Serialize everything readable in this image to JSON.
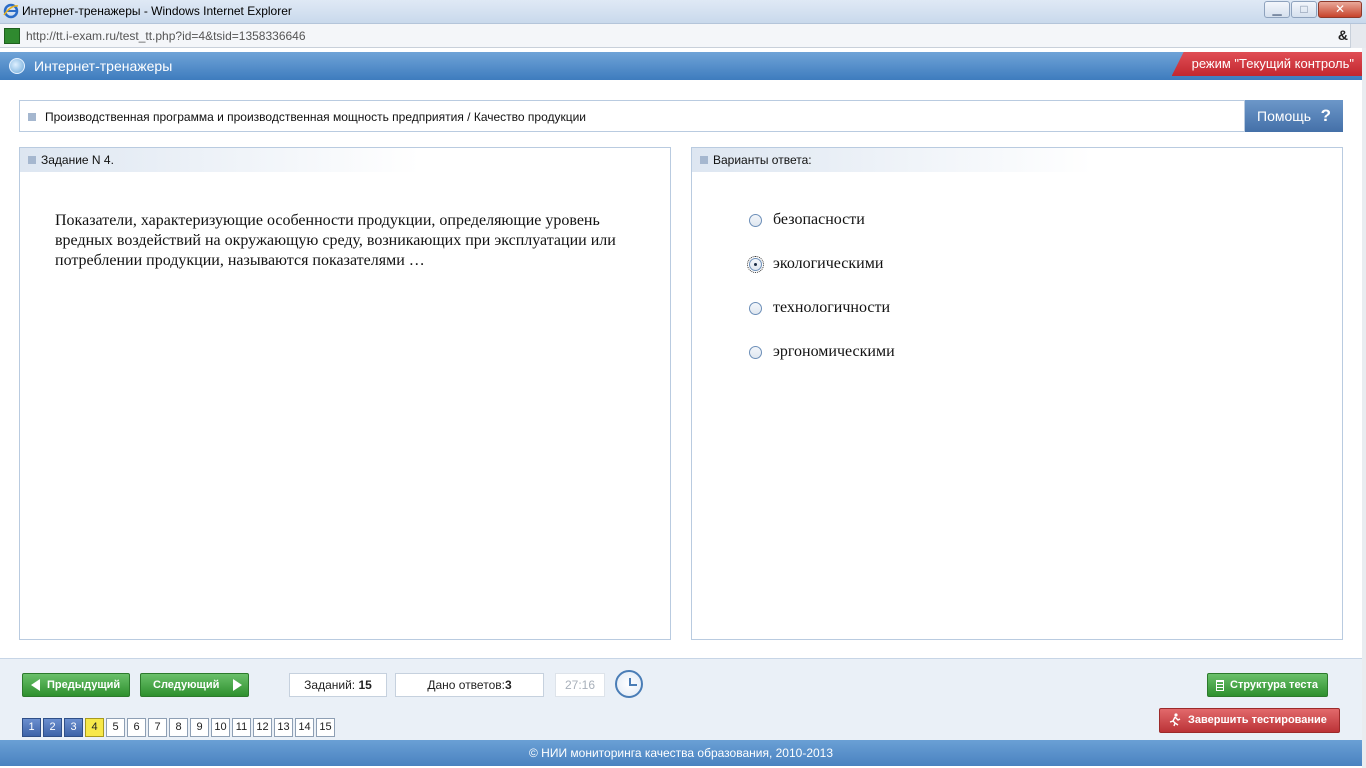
{
  "window": {
    "title": "Интернет-тренажеры - Windows Internet Explorer",
    "url": "http://tt.i-exam.ru/test_tt.php?id=4&tsid=1358336646",
    "min_glyph": "▁",
    "max_glyph": "□",
    "close_glyph": "✕",
    "tools_glyph": "&"
  },
  "app": {
    "title": "Интернет-тренажеры",
    "mode": "режим \"Текущий контроль\""
  },
  "topic": {
    "text": "Производственная программа и производственная мощность предприятия / Качество продукции",
    "help_label": "Помощь",
    "help_icon": "?"
  },
  "question": {
    "header": "Задание N 4.",
    "text": "Показатели, характеризующие особенности продукции, определяющие уровень вредных воздействий на окружающую среду, возникающих при эксплуатации или потреблении продукции, называются показателями …"
  },
  "answers": {
    "header": "Варианты ответа:",
    "options": [
      {
        "label": "безопасности",
        "selected": false
      },
      {
        "label": "экологическими",
        "selected": true
      },
      {
        "label": "технологичности",
        "selected": false
      },
      {
        "label": "эргономическими",
        "selected": false
      }
    ]
  },
  "nav": {
    "prev_label": "Предыдущий",
    "next_label": "Следующий",
    "tasks_label": "Заданий:",
    "tasks_count": "15",
    "answers_label": "Дано ответов:",
    "answers_count": "3",
    "timer": "27:16",
    "structure_label": "Структура теста",
    "finish_label": "Завершить тестирование",
    "pages": [
      {
        "n": "1",
        "state": "done"
      },
      {
        "n": "2",
        "state": "done"
      },
      {
        "n": "3",
        "state": "done"
      },
      {
        "n": "4",
        "state": "current"
      },
      {
        "n": "5",
        "state": "none"
      },
      {
        "n": "6",
        "state": "none"
      },
      {
        "n": "7",
        "state": "none"
      },
      {
        "n": "8",
        "state": "none"
      },
      {
        "n": "9",
        "state": "none"
      },
      {
        "n": "10",
        "state": "none"
      },
      {
        "n": "11",
        "state": "none"
      },
      {
        "n": "12",
        "state": "none"
      },
      {
        "n": "13",
        "state": "none"
      },
      {
        "n": "14",
        "state": "none"
      },
      {
        "n": "15",
        "state": "none"
      }
    ]
  },
  "footer": {
    "copyright": "© НИИ мониторинга качества образования, 2010-2013"
  },
  "colors": {
    "header_blue": "#3e7cbe",
    "mode_red": "#c2272f",
    "nav_green": "#2e902e",
    "finish_red": "#bb3337",
    "current_page": "#f7e84a"
  }
}
